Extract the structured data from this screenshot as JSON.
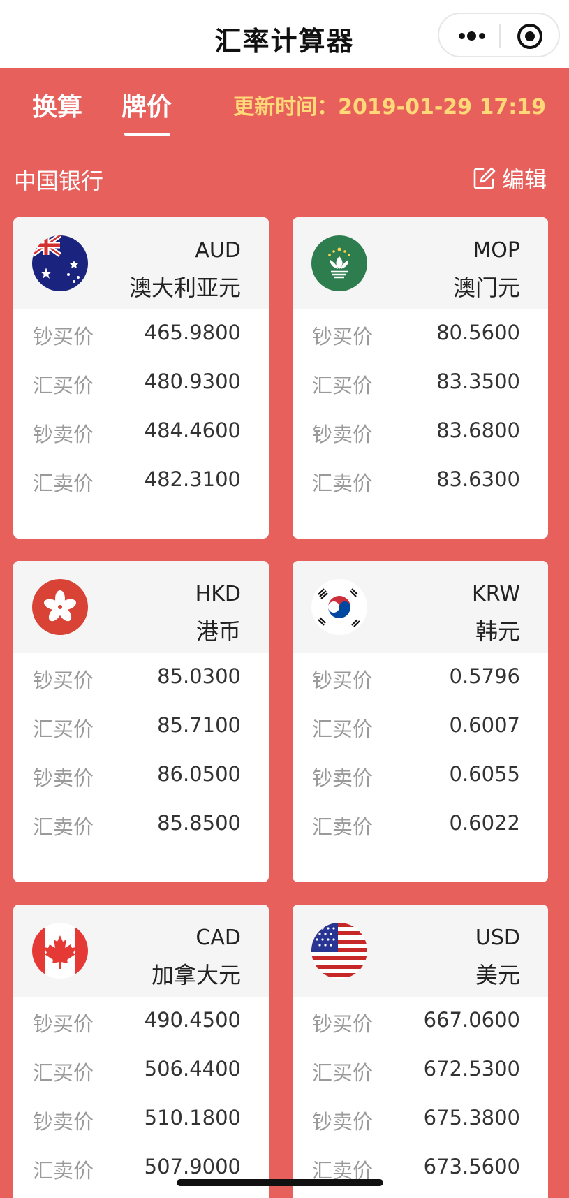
{
  "app": {
    "title": "汇率计算器"
  },
  "tabs": [
    {
      "label": "换算",
      "active": false
    },
    {
      "label": "牌价",
      "active": true
    }
  ],
  "update_time": "更新时间：2019-01-29 17:19",
  "bank": {
    "name": "中国银行",
    "edit_label": "编辑"
  },
  "rate_labels": [
    "钞买价",
    "汇买价",
    "钞卖价",
    "汇卖价"
  ],
  "currencies": [
    {
      "code": "AUD",
      "name": "澳大利亚元",
      "rates": [
        "465.9800",
        "480.9300",
        "484.4600",
        "482.3100"
      ]
    },
    {
      "code": "MOP",
      "name": "澳门元",
      "rates": [
        "80.5600",
        "83.3500",
        "83.6800",
        "83.6300"
      ]
    },
    {
      "code": "HKD",
      "name": "港币",
      "rates": [
        "85.0300",
        "85.7100",
        "86.0500",
        "85.8500"
      ]
    },
    {
      "code": "KRW",
      "name": "韩元",
      "rates": [
        "0.5796",
        "0.6007",
        "0.6055",
        "0.6022"
      ]
    },
    {
      "code": "CAD",
      "name": "加拿大元",
      "rates": [
        "490.4500",
        "506.4400",
        "510.1800",
        "507.9000"
      ]
    },
    {
      "code": "USD",
      "name": "美元",
      "rates": [
        "667.0600",
        "672.5300",
        "675.3800",
        "673.5600"
      ]
    }
  ],
  "colors": {
    "background": "#e8605c",
    "update_time": "#ffd978",
    "card_head": "#f5f5f5"
  }
}
